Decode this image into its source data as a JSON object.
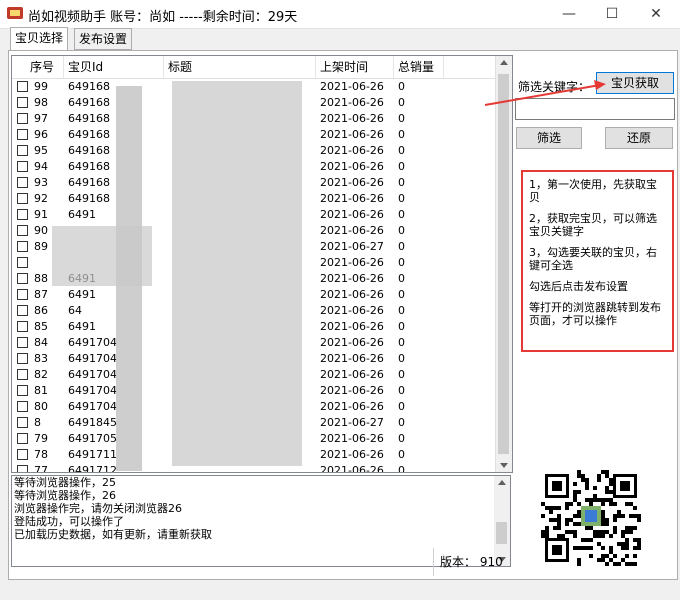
{
  "window": {
    "title": "尚如视频助手  账号：尚如     -----剩余时间：29天",
    "minimize": "—",
    "maximize": "☐",
    "close": "✕"
  },
  "tabs": [
    {
      "label": "宝贝选择",
      "active": true
    },
    {
      "label": "发布设置",
      "active": false
    }
  ],
  "table": {
    "headers": [
      "序号",
      "宝贝Id",
      "标题",
      "上架时间",
      "总销量"
    ],
    "rows": [
      {
        "no": "99",
        "id": "649168",
        "date": "2021-06-26",
        "sales": "0"
      },
      {
        "no": "98",
        "id": "649168",
        "date": "2021-06-26",
        "sales": "0"
      },
      {
        "no": "97",
        "id": "649168",
        "date": "2021-06-26",
        "sales": "0"
      },
      {
        "no": "96",
        "id": "649168",
        "date": "2021-06-26",
        "sales": "0"
      },
      {
        "no": "95",
        "id": "649168",
        "date": "2021-06-26",
        "sales": "0"
      },
      {
        "no": "94",
        "id": "649168",
        "date": "2021-06-26",
        "sales": "0"
      },
      {
        "no": "93",
        "id": "649168",
        "date": "2021-06-26",
        "sales": "0"
      },
      {
        "no": "92",
        "id": "649168",
        "date": "2021-06-26",
        "sales": "0"
      },
      {
        "no": "91",
        "id": "6491",
        "date": "2021-06-26",
        "sales": "0"
      },
      {
        "no": "90",
        "id": "",
        "date": "2021-06-26",
        "sales": "0"
      },
      {
        "no": "89",
        "id": "",
        "date": "2021-06-27",
        "sales": "0"
      },
      {
        "no": "",
        "id": "",
        "date": "2021-06-26",
        "sales": "0"
      },
      {
        "no": "88",
        "id": "6491",
        "date": "2021-06-26",
        "sales": "0"
      },
      {
        "no": "87",
        "id": "6491",
        "date": "2021-06-26",
        "sales": "0"
      },
      {
        "no": "86",
        "id": "64",
        "date": "2021-06-26",
        "sales": "0"
      },
      {
        "no": "85",
        "id": "6491",
        "date": "2021-06-26",
        "sales": "0"
      },
      {
        "no": "84",
        "id": "6491704",
        "date": "2021-06-26",
        "sales": "0"
      },
      {
        "no": "83",
        "id": "6491704",
        "date": "2021-06-26",
        "sales": "0"
      },
      {
        "no": "82",
        "id": "6491704",
        "date": "2021-06-26",
        "sales": "0"
      },
      {
        "no": "81",
        "id": "6491704",
        "date": "2021-06-26",
        "sales": "0"
      },
      {
        "no": "80",
        "id": "6491704",
        "date": "2021-06-26",
        "sales": "0"
      },
      {
        "no": "8",
        "id": "6491845",
        "date": "2021-06-27",
        "sales": "0"
      },
      {
        "no": "79",
        "id": "6491705",
        "date": "2021-06-26",
        "sales": "0"
      },
      {
        "no": "78",
        "id": "6491711",
        "date": "2021-06-26",
        "sales": "0"
      },
      {
        "no": "77",
        "id": "6491712",
        "date": "2021-06-26",
        "sales": "0"
      }
    ]
  },
  "log": [
    "等待浏览器操作，25",
    "等待浏览器操作，26",
    "浏览器操作完，请勿关闭浏览器26",
    "登陆成功，可以操作了",
    "已加载历史数据，如有更新，请重新获取"
  ],
  "filter": {
    "label": "筛选关键字：",
    "fetch_button": "宝贝获取",
    "input_value": "",
    "filter_button": "筛选",
    "reset_button": "还原"
  },
  "help": [
    "1，第一次使用，先获取宝贝",
    "2，获取完宝贝，可以筛选宝贝关键字",
    "3，勾选要关联的宝贝，右键可全选",
    "勾选后点击发布设置",
    "等打开的浏览器跳转到发布页面，才可以操作"
  ],
  "version": {
    "label": "版本：",
    "value": "910"
  },
  "colors": {
    "accent": "#e53935",
    "button_border": "#0078d7"
  }
}
